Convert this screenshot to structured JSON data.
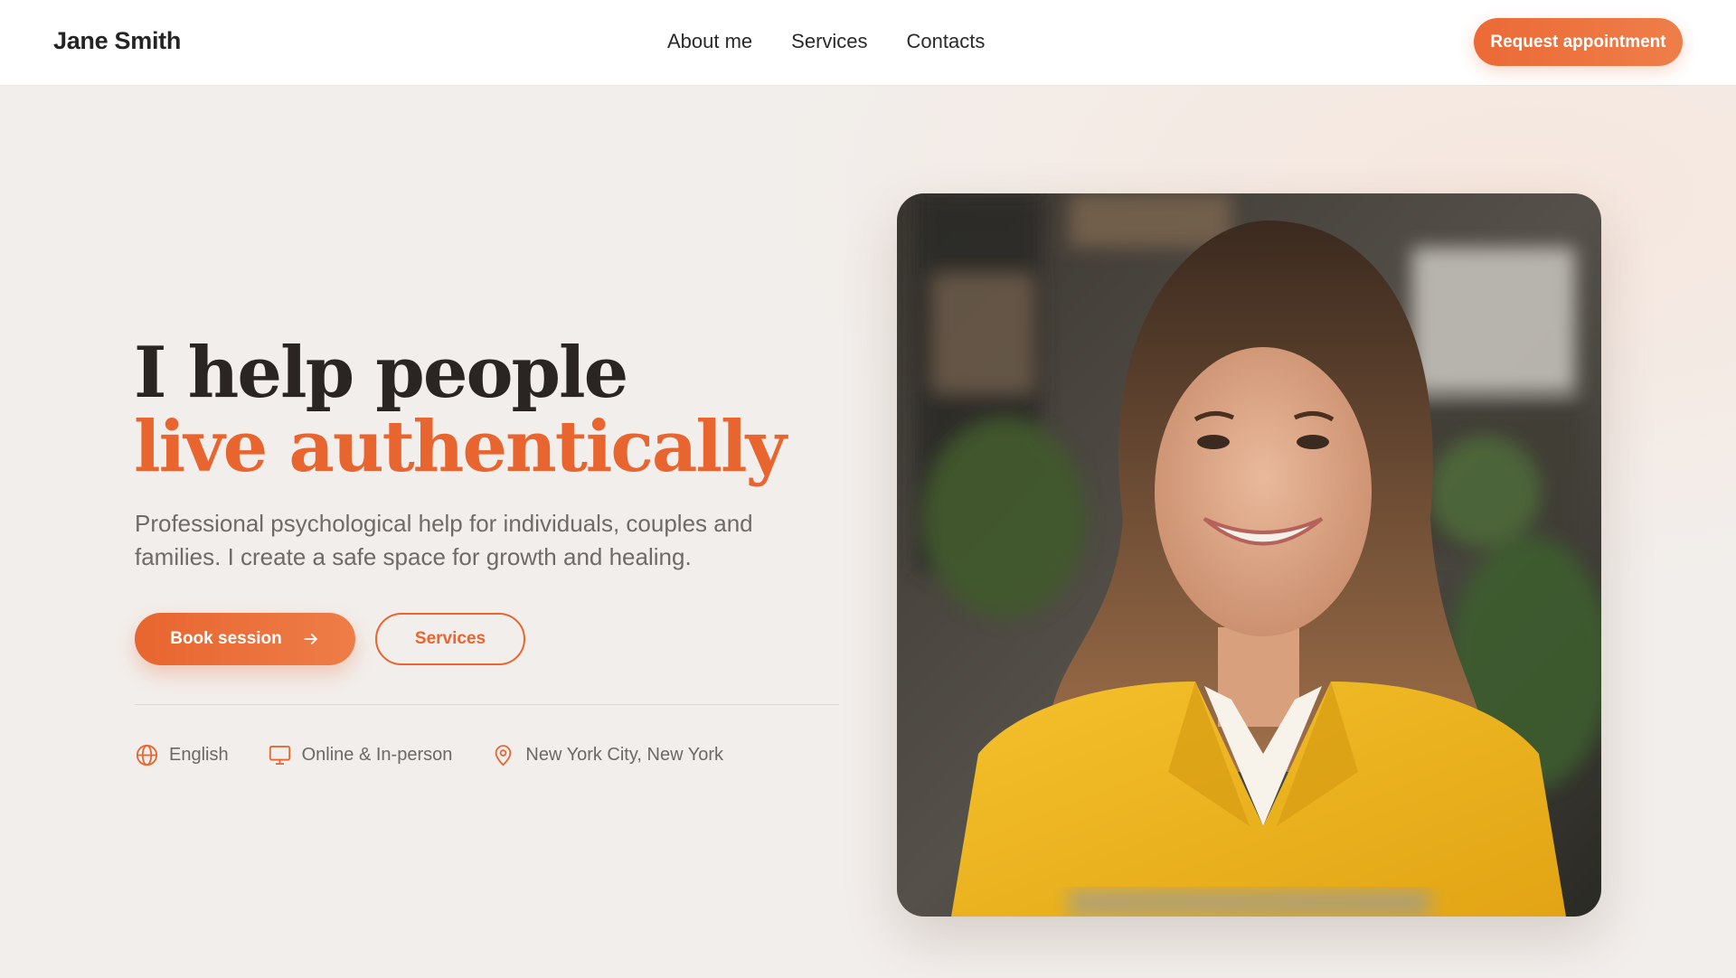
{
  "header": {
    "brand": "Jane Smith",
    "nav": [
      "About me",
      "Services",
      "Contacts"
    ],
    "cta": "Request appointment"
  },
  "hero": {
    "title_line1": "I help people",
    "title_line2": "live authentically",
    "subtitle": "Professional psychological help for individuals, couples and families. I create a safe space for growth and healing.",
    "primary_button": "Book session",
    "primary_button_icon": "arrow-right-icon",
    "secondary_button": "Services",
    "meta": [
      {
        "icon": "globe-icon",
        "label": "English"
      },
      {
        "icon": "monitor-icon",
        "label": "Online & In-person"
      },
      {
        "icon": "map-pin-icon",
        "label": "New York City, New York"
      }
    ]
  },
  "colors": {
    "accent": "#e8652f",
    "background": "#f2eeeb",
    "heading": "#2a2522",
    "body_text": "#6f6a66"
  }
}
